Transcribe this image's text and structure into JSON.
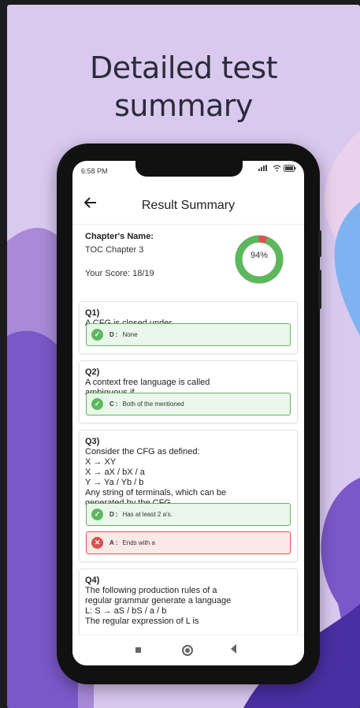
{
  "promo": {
    "headline_line1": "Detailed test",
    "headline_line2": "summary"
  },
  "status_bar": {
    "time": "6:58 PM"
  },
  "app_bar": {
    "back_icon": "arrow-left-icon",
    "title": "Result Summary"
  },
  "summary": {
    "chapter_label": "Chapter's Name:",
    "chapter_value": "TOC Chapter 3",
    "score_text": "Your Score: 18/19",
    "percent_label": "94%",
    "percent_value": 0.94,
    "colors": {
      "correct": "#5cb85c",
      "wrong": "#d9534f"
    }
  },
  "questions": [
    {
      "number": "Q1)",
      "lines": [
        "A CFG is closed under"
      ],
      "answers": [
        {
          "status": "correct",
          "letter": "D",
          "text": "None"
        }
      ]
    },
    {
      "number": "Q2)",
      "lines": [
        "A context free language is called",
        "ambiguous if"
      ],
      "answers": [
        {
          "status": "correct",
          "letter": "C",
          "text": "Both of the mentioned"
        }
      ]
    },
    {
      "number": "Q3)",
      "lines": [
        "Consider the CFG as defined:",
        "X → XY",
        "X → aX / bX / a",
        "Y → Ya / Yb / b",
        "Any string of terminals, which can be",
        "generated by the CFG"
      ],
      "answers": [
        {
          "status": "correct",
          "letter": "D",
          "text": "Has at least 2 a's."
        },
        {
          "status": "wrong",
          "letter": "A",
          "text": "Ends with a"
        }
      ]
    },
    {
      "number": "Q4)",
      "lines": [
        "The following production rules of a",
        "regular grammar generate a language",
        "L: S → aS / bS / a / b",
        "The regular expression of L is"
      ],
      "answers": []
    }
  ],
  "nav_bar": {
    "recents_icon": "square-icon",
    "home_icon": "circle-icon",
    "back_icon": "triangle-back-icon"
  }
}
